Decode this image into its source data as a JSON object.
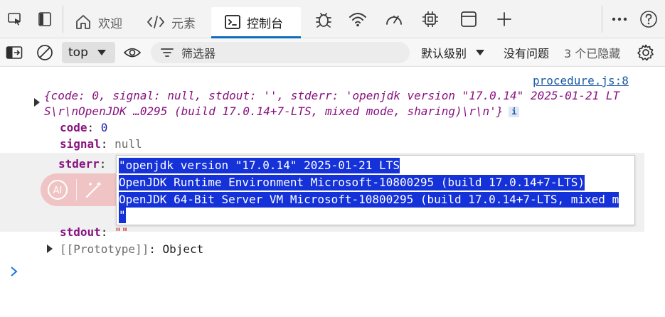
{
  "tabbar": {
    "tabs": [
      {
        "label": "欢迎",
        "icon": "home-icon"
      },
      {
        "label": "元素",
        "icon": "code-icon"
      },
      {
        "label": "控制台",
        "icon": "console-icon"
      }
    ],
    "active_tab": "控制台",
    "extra_icons": [
      "sources-bug-icon",
      "network-wifi-icon",
      "performance-gauge-icon",
      "memory-chip-icon",
      "application-panel-icon",
      "add-tab-icon"
    ]
  },
  "filterbar": {
    "context": "top",
    "filter_placeholder": "筛选器",
    "levels_label": "默认级别",
    "issues_label": "没有问题",
    "hidden_label": "3 个已隐藏"
  },
  "console": {
    "source_link": "procedure.js:8",
    "summary_line1": "{code: 0, signal: null, stdout: '', stderr: 'openjdk version \"17.0.14\" 2025-01-21 LT",
    "summary_line2": "S\\r\\nOpenJDK …0295 (build 17.0.14+7-LTS, mixed mode, sharing)\\r\\n'}",
    "info_badge": "i",
    "props": {
      "code_key": "code",
      "code_val": "0",
      "signal_key": "signal",
      "signal_val": "null",
      "stderr_key": "stderr",
      "stdout_key": "stdout",
      "stdout_val": "\"\"",
      "prototype_key": "[[Prototype]]",
      "prototype_val": "Object"
    },
    "stderr_lines": [
      "\"openjdk version \"17.0.14\" 2025-01-21 LTS",
      "OpenJDK Runtime Environment Microsoft-10800295 (build 17.0.14+7-LTS)",
      "OpenJDK 64-Bit Server VM Microsoft-10800295 (build 17.0.14+7-LTS, mixed m",
      "\""
    ],
    "ai_label": "AI"
  }
}
